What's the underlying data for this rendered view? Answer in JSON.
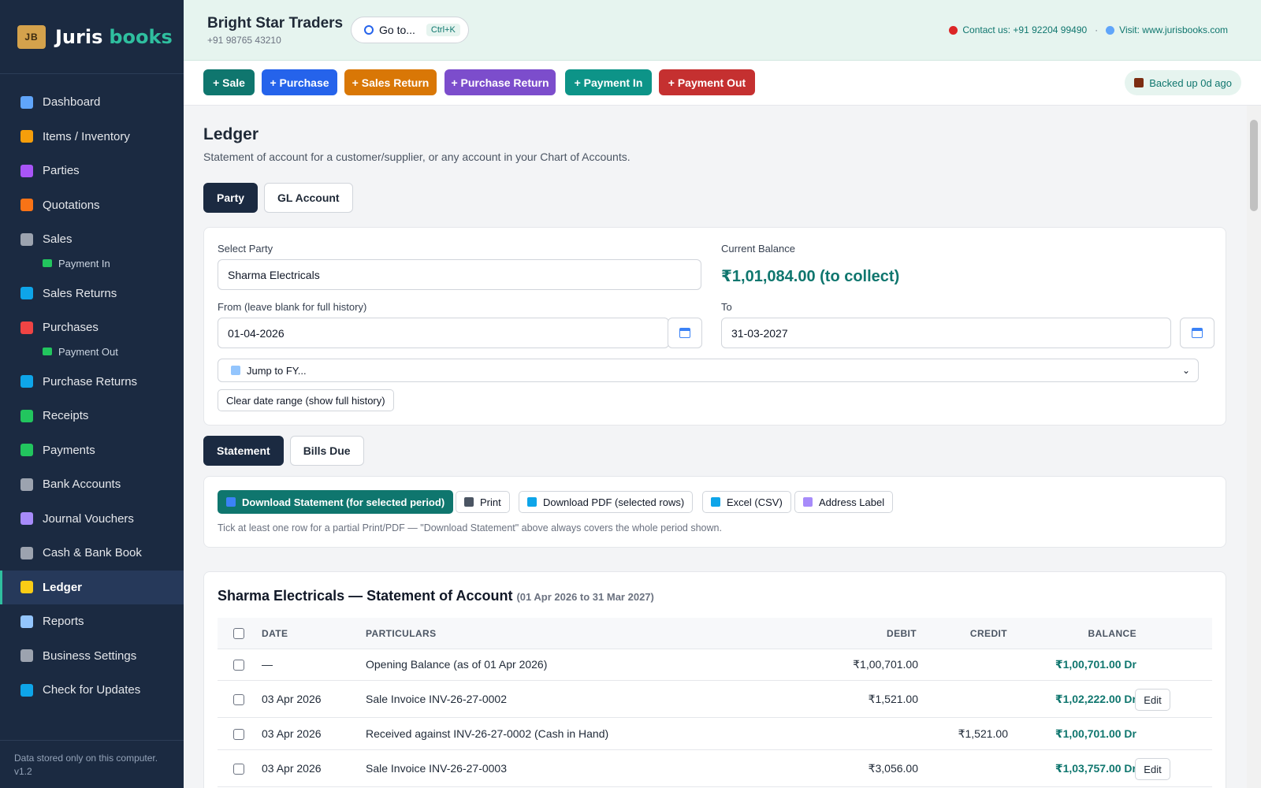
{
  "brand": {
    "logo_text": "JB",
    "name_part1": "Juris",
    "name_part2": "books"
  },
  "sidebar": {
    "items": [
      {
        "label": "Dashboard",
        "icon": "chart-icon",
        "color": "#60a5fa"
      },
      {
        "label": "Items / Inventory",
        "icon": "box-icon",
        "color": "#f59e0b"
      },
      {
        "label": "Parties",
        "icon": "people-icon",
        "color": "#a855f7"
      },
      {
        "label": "Quotations",
        "icon": "memo-icon",
        "color": "#f97316"
      },
      {
        "label": "Sales",
        "icon": "receipt-icon",
        "color": "#9ca3af"
      },
      {
        "label": "Payment In",
        "icon": "cash-icon",
        "color": "#22c55e",
        "sub": true
      },
      {
        "label": "Sales Returns",
        "icon": "return-icon",
        "color": "#0ea5e9"
      },
      {
        "label": "Purchases",
        "icon": "cart-icon",
        "color": "#ef4444"
      },
      {
        "label": "Payment Out",
        "icon": "cash-icon",
        "color": "#22c55e",
        "sub": true
      },
      {
        "label": "Purchase Returns",
        "icon": "return-icon",
        "color": "#0ea5e9"
      },
      {
        "label": "Receipts",
        "icon": "cash-icon",
        "color": "#22c55e"
      },
      {
        "label": "Payments",
        "icon": "money-wings-icon",
        "color": "#22c55e"
      },
      {
        "label": "Bank Accounts",
        "icon": "bank-icon",
        "color": "#9ca3af"
      },
      {
        "label": "Journal Vouchers",
        "icon": "notebook-icon",
        "color": "#a78bfa"
      },
      {
        "label": "Cash & Bank Book",
        "icon": "bank-icon",
        "color": "#9ca3af"
      },
      {
        "label": "Ledger",
        "icon": "ledger-icon",
        "color": "#facc15",
        "active": true
      },
      {
        "label": "Reports",
        "icon": "trend-icon",
        "color": "#93c5fd"
      },
      {
        "label": "Business Settings",
        "icon": "gear-icon",
        "color": "#9ca3af"
      },
      {
        "label": "Check for Updates",
        "icon": "refresh-icon",
        "color": "#0ea5e9"
      }
    ],
    "footer_line1": "Data stored only on this computer.",
    "footer_line2": "v1.2"
  },
  "header": {
    "business_name": "Bright Star Traders",
    "business_phone": "+91 98765 43210",
    "goto_label": "Go to...",
    "goto_shortcut": "Ctrl+K",
    "contact": "Contact us: +91 92204 99490",
    "separator": "·",
    "visit": "Visit: www.jurisbooks.com"
  },
  "actions": {
    "buttons": [
      {
        "label": "+ Sale",
        "color": "#0f766e"
      },
      {
        "label": "+ Purchase",
        "color": "#2563eb"
      },
      {
        "label": "+ Sales Return",
        "color": "#d97706"
      },
      {
        "label": "+ Purchase Return",
        "color": "#7c4dcc"
      },
      {
        "label": "+ Payment In",
        "color": "#0d9488"
      },
      {
        "label": "+ Payment Out",
        "color": "#c53030"
      }
    ],
    "backup_label": "Backed up 0d ago"
  },
  "ledger": {
    "title": "Ledger",
    "subtitle": "Statement of account for a customer/supplier, or any account in your Chart of Accounts.",
    "tabs": [
      "Party",
      "GL Account"
    ],
    "select_party_label": "Select Party",
    "party_value": "Sharma Electricals",
    "current_balance_label": "Current Balance",
    "current_balance": "₹1,01,084.00 (to collect)",
    "from_label": "From (leave blank for full history)",
    "from_value": "01-04-2026",
    "to_label": "To",
    "to_value": "31-03-2027",
    "fy_select": "Jump to FY...",
    "clear_label": "Clear date range (show full history)"
  },
  "view_tabs": [
    "Statement",
    "Bills Due"
  ],
  "export": {
    "download_statement": "Download Statement (for selected period)",
    "print": "Print",
    "download_pdf": "Download PDF (selected rows)",
    "excel": "Excel (CSV)",
    "address_label": "Address Label",
    "hint": "Tick at least one row for a partial Print/PDF — \"Download Statement\" above always covers the whole period shown."
  },
  "statement": {
    "title": "Sharma Electricals — Statement of Account",
    "range": "(01 Apr 2026 to 31 Mar 2027)",
    "columns": [
      "DATE",
      "PARTICULARS",
      "DEBIT",
      "CREDIT",
      "BALANCE"
    ],
    "edit_label": "Edit",
    "rows": [
      {
        "date": "—",
        "particulars": "Opening Balance (as of 01 Apr 2026)",
        "debit": "₹1,00,701.00",
        "credit": "",
        "balance": "₹1,00,701.00 Dr",
        "editable": false
      },
      {
        "date": "03 Apr 2026",
        "particulars": "Sale Invoice INV-26-27-0002",
        "debit": "₹1,521.00",
        "credit": "",
        "balance": "₹1,02,222.00 Dr",
        "editable": true
      },
      {
        "date": "03 Apr 2026",
        "particulars": "Received against INV-26-27-0002 (Cash in Hand)",
        "debit": "",
        "credit": "₹1,521.00",
        "balance": "₹1,00,701.00 Dr",
        "editable": false
      },
      {
        "date": "03 Apr 2026",
        "particulars": "Sale Invoice INV-26-27-0003",
        "debit": "₹3,056.00",
        "credit": "",
        "balance": "₹1,03,757.00 Dr",
        "editable": true
      }
    ]
  }
}
